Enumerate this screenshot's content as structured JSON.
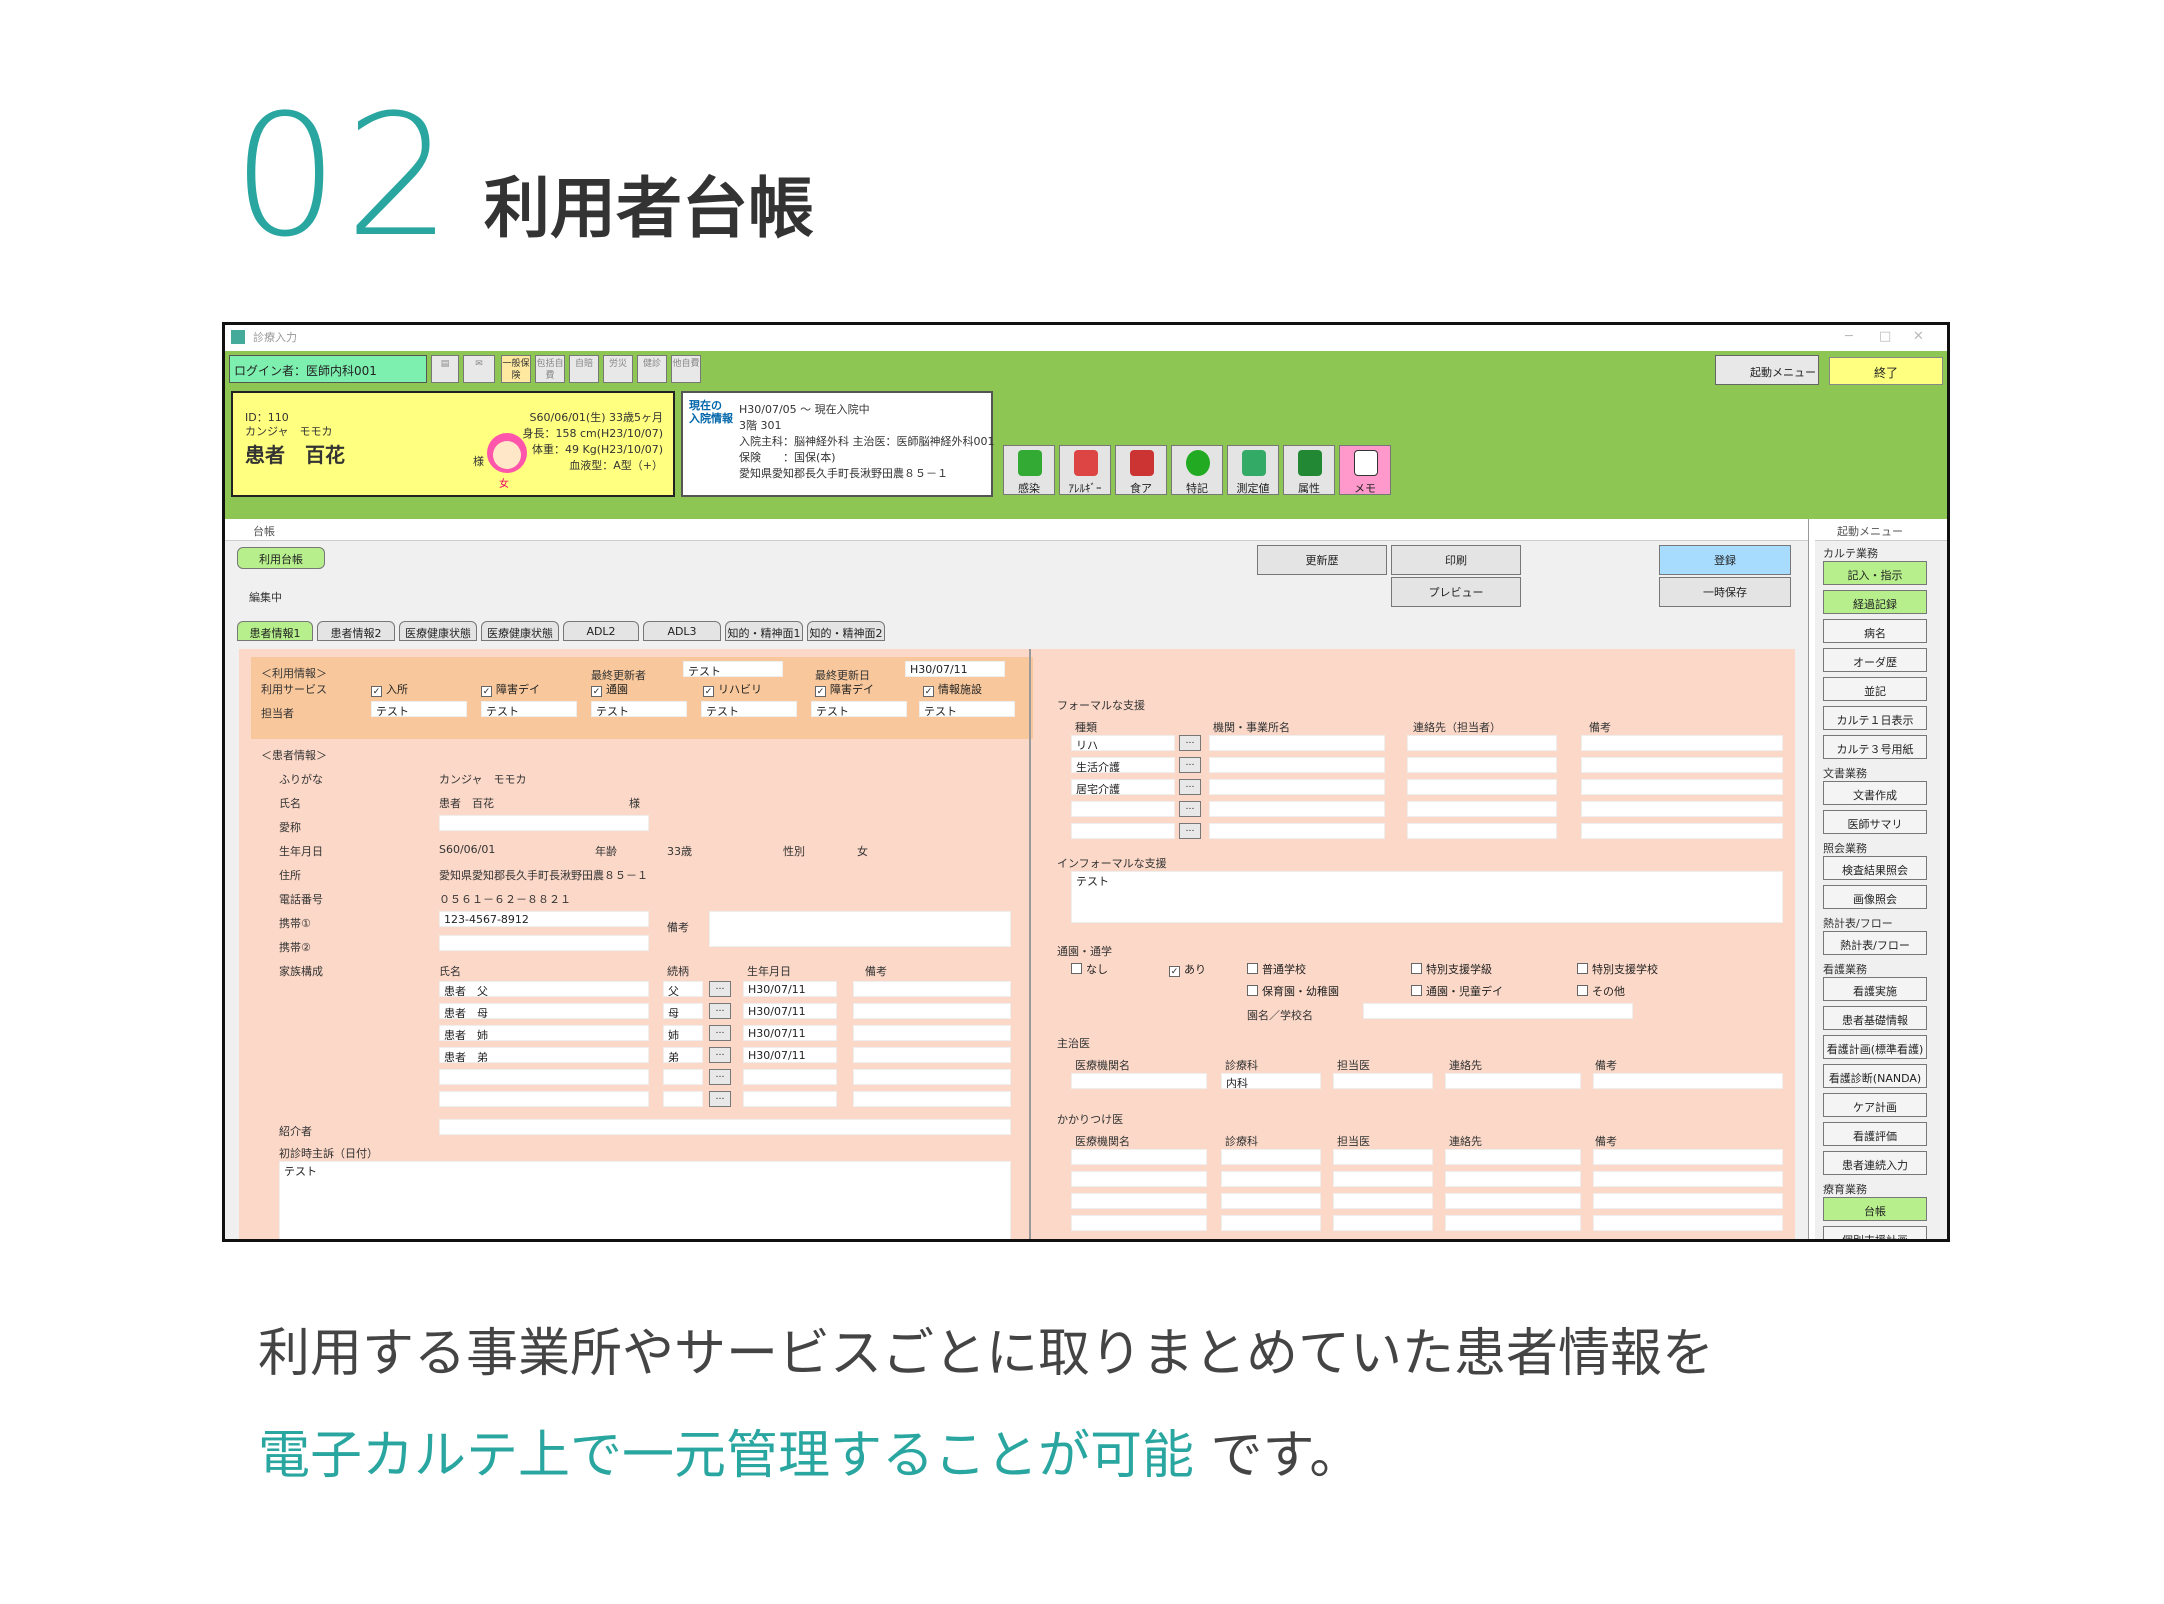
{
  "section": {
    "number": "02",
    "title": "利用者台帳"
  },
  "caption": {
    "line1": "利用する事業所やサービスごとに取りまとめていた患者情報を",
    "line2_highlight": "電子カルテ上で一元管理することが可能",
    "line2_rest": " です。"
  },
  "app": {
    "window_title": "診療入力",
    "login": "ログイン者：医師内科001",
    "toolbar_small": [
      "一般保険",
      "包括自費",
      "自賠",
      "労災",
      "健診",
      "他自費"
    ],
    "start_menu": "起動メニュー",
    "end": "終了",
    "patient": {
      "id": "ID：110",
      "kana": "カンジャ　モモカ",
      "name": "患者　百花",
      "honorific": "様",
      "sex": "女",
      "dob": "S60/06/01(生) 33歳5ヶ月",
      "height": "身長：158 cm(H23/10/07)",
      "weight": "体重：49 Kg(H23/10/07)",
      "blood": "血液型：A型（+）"
    },
    "admission": {
      "label": "現在の\n入院情報",
      "period": "H30/07/05 ～ 現在入院中",
      "room": "3階 301",
      "dept": "入院主科：脳神経外科 主治医：医師脳神経外科001",
      "insurance": "保険　　：国保(本)",
      "address": "愛知県愛知郡長久手町長湫野田農８５－１"
    },
    "icon_buttons": [
      "感染",
      "ｱﾚﾙｷﾞｰ",
      "食ア",
      "特記",
      "測定値",
      "属性",
      "メモ"
    ]
  },
  "ledger": {
    "panel_title": "台帳",
    "main_button": "利用台帳",
    "mode": "編集中",
    "buttons": {
      "history": "更新歴",
      "print": "印刷",
      "preview": "プレビュー",
      "register": "登録",
      "temp_save": "一時保存"
    },
    "tabs": [
      "患者情報1",
      "患者情報2",
      "医療健康状態",
      "医療健康状態",
      "ADL2",
      "ADL3",
      "知的・精神面1",
      "知的・精神面2"
    ],
    "usage": {
      "header": "＜利用情報＞",
      "service_label": "利用サービス",
      "last_updater_label": "最終更新者",
      "last_updater": "テスト",
      "last_update_label": "最終更新日",
      "last_update": "H30/07/11",
      "services": [
        "入所",
        "障害デイ",
        "通園",
        "リハビリ",
        "障害デイ",
        "情報施設"
      ],
      "staff_label": "担当者",
      "staff": [
        "テスト",
        "テスト",
        "テスト",
        "テスト",
        "テスト",
        "テスト"
      ]
    },
    "patient_info": {
      "header": "＜患者情報＞",
      "labels": [
        "ふりがな",
        "氏名",
        "愛称",
        "生年月日",
        "住所",
        "電話番号",
        "携帯①",
        "携帯②",
        "家族構成"
      ],
      "furigana": "カンジャ　モモカ",
      "name": "患者　百花",
      "name_suffix": "様",
      "dob": "S60/06/01",
      "age_label": "年齢",
      "age": "33歳",
      "sex_label": "性別",
      "sex": "女",
      "address": "愛知県愛知郡長久手町長湫野田農８５－１",
      "phone": "０５６１－６２－８８２１",
      "mobile1": "123-4567-8912",
      "remarks_label": "備考",
      "family_headers": [
        "氏名",
        "続柄",
        "生年月日",
        "備考"
      ],
      "family": [
        {
          "name": "患者　父",
          "rel": "父",
          "dob": "H30/07/11"
        },
        {
          "name": "患者　母",
          "rel": "母",
          "dob": "H30/07/11"
        },
        {
          "name": "患者　姉",
          "rel": "姉",
          "dob": "H30/07/11"
        },
        {
          "name": "患者　弟",
          "rel": "弟",
          "dob": "H30/07/11"
        }
      ],
      "referrer_label": "紹介者",
      "complaint_label": "初診時主訴（日付）",
      "complaint": "テスト"
    },
    "right": {
      "formal_label": "フォーマルな支援",
      "formal_headers": [
        "種類",
        "機関・事業所名",
        "連絡先（担当者）",
        "備考"
      ],
      "formal_types": [
        "リハ",
        "生活介護",
        "居宅介護",
        "",
        ""
      ],
      "informal_label": "インフォーマルな支援",
      "informal": "テスト",
      "school_label": "通園・通学",
      "school_options": [
        "なし",
        "あり",
        "普通学校",
        "特別支援学級",
        "特別支援学校",
        "保育園・幼稚園",
        "通園・児童デイ",
        "その他"
      ],
      "school_name_label": "園名／学校名",
      "doctor_label": "主治医",
      "doctor_headers": [
        "医療機関名",
        "診療科",
        "担当医",
        "連絡先",
        "備考"
      ],
      "doctor_dept": "内科",
      "family_doctor_label": "かかりつけ医",
      "family_doctor_headers": [
        "医療機関名",
        "診療科",
        "担当医",
        "連絡先",
        "備考"
      ]
    }
  },
  "sidebar": {
    "title": "起動メニュー",
    "groups": [
      {
        "label": "カルテ業務",
        "items": [
          "記入・指示",
          "経過記録",
          "病名",
          "オーダ歴",
          "並記",
          "カルテ１日表示",
          "カルテ３号用紙"
        ]
      },
      {
        "label": "文書業務",
        "items": [
          "文書作成",
          "医師サマリ"
        ]
      },
      {
        "label": "照会業務",
        "items": [
          "検査結果照会",
          "画像照会"
        ]
      },
      {
        "label": "熱計表/フロー",
        "items": [
          "熱計表/フロー"
        ]
      },
      {
        "label": "看護業務",
        "items": [
          "看護実施",
          "患者基礎情報",
          "看護計画(標準看護)",
          "看護診断(NANDA)",
          "ケア計画",
          "看護評価",
          "患者連続入力"
        ]
      },
      {
        "label": "療育業務",
        "items": [
          "台帳",
          "個別支援計画"
        ]
      }
    ]
  }
}
